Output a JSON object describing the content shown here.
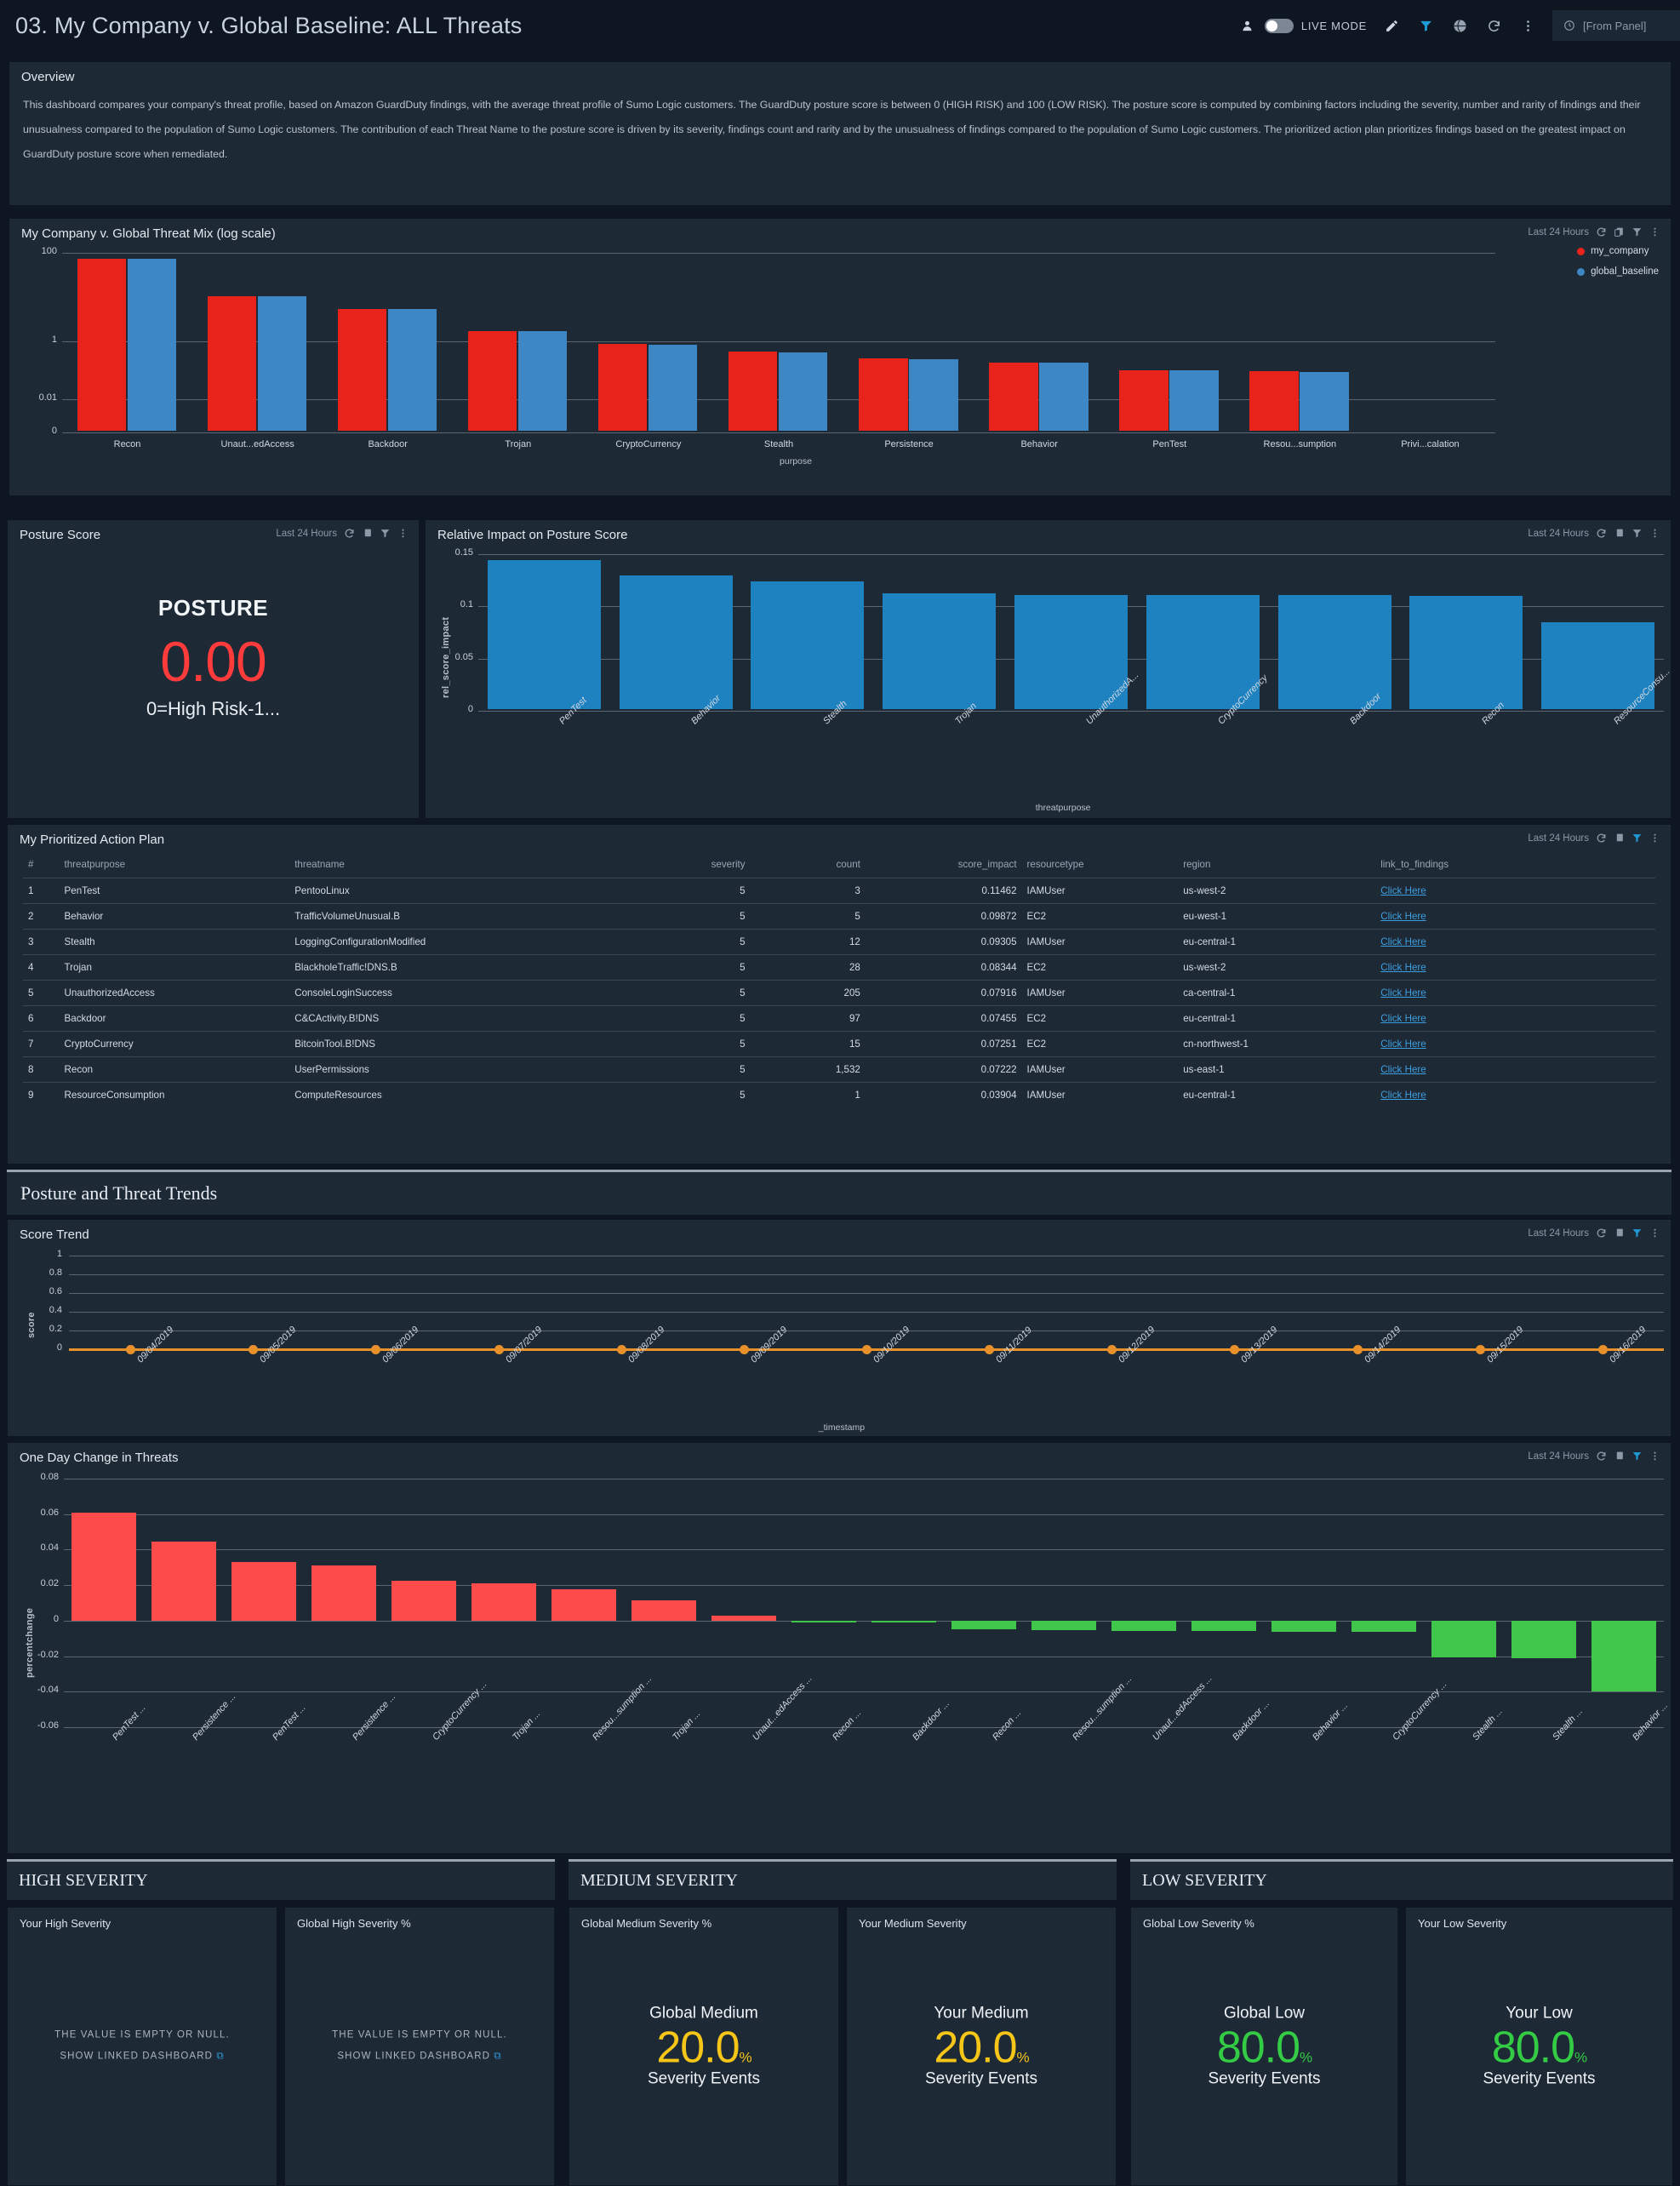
{
  "header": {
    "title": "03. My Company v. Global Baseline: ALL Threats",
    "live_mode_label": "LIVE MODE",
    "time_range": "[From Panel]",
    "icons": [
      "person-icon",
      "edit-pencil-icon",
      "filter-icon",
      "globe-icon",
      "refresh-icon",
      "more-vertical-icon",
      "clock-icon"
    ]
  },
  "overview": {
    "title": "Overview",
    "text": "This dashboard compares your company's threat profile, based on Amazon GuardDuty findings, with the average threat profile of Sumo Logic customers. The GuardDuty posture score is between 0 (HIGH RISK) and 100 (LOW RISK). The posture score is computed by combining factors including the severity, number and rarity of findings and their unusualness compared to the population of Sumo Logic customers. The contribution of each Threat Name to the posture score is driven by its severity, findings count and rarity and by the unusualness of findings compared to the population of Sumo Logic customers. The prioritized action plan prioritizes findings based on the greatest impact on GuardDuty posture score when remediated."
  },
  "panel_meta": {
    "time_label": "Last 24 Hours"
  },
  "threat_mix": {
    "title": "My Company v. Global Threat Mix (log scale)",
    "legend": [
      "my_company",
      "global_baseline"
    ]
  },
  "posture": {
    "title": "Posture Score",
    "label": "POSTURE",
    "value": "0.00",
    "caption": "0=High Risk-1...",
    "color": "#ff3b3b"
  },
  "rel_impact": {
    "title": "Relative Impact on Posture Score"
  },
  "action_plan": {
    "title": "My Prioritized Action Plan",
    "columns": [
      "#",
      "threatpurpose",
      "threatname",
      "severity",
      "count",
      "score_impact",
      "resourcetype",
      "region",
      "link_to_findings"
    ],
    "rows": [
      [
        "1",
        "PenTest",
        "PentooLinux",
        "5",
        "3",
        "0.11462",
        "IAMUser",
        "us-west-2",
        "Click Here"
      ],
      [
        "2",
        "Behavior",
        "TrafficVolumeUnusual.B",
        "5",
        "5",
        "0.09872",
        "EC2",
        "eu-west-1",
        "Click Here"
      ],
      [
        "3",
        "Stealth",
        "LoggingConfigurationModified",
        "5",
        "12",
        "0.09305",
        "IAMUser",
        "eu-central-1",
        "Click Here"
      ],
      [
        "4",
        "Trojan",
        "BlackholeTraffic!DNS.B",
        "5",
        "28",
        "0.08344",
        "EC2",
        "us-west-2",
        "Click Here"
      ],
      [
        "5",
        "UnauthorizedAccess",
        "ConsoleLoginSuccess",
        "5",
        "205",
        "0.07916",
        "IAMUser",
        "ca-central-1",
        "Click Here"
      ],
      [
        "6",
        "Backdoor",
        "C&CActivity.B!DNS",
        "5",
        "97",
        "0.07455",
        "EC2",
        "eu-central-1",
        "Click Here"
      ],
      [
        "7",
        "CryptoCurrency",
        "BitcoinTool.B!DNS",
        "5",
        "15",
        "0.07251",
        "EC2",
        "cn-northwest-1",
        "Click Here"
      ],
      [
        "8",
        "Recon",
        "UserPermissions",
        "5",
        "1,532",
        "0.07222",
        "IAMUser",
        "us-east-1",
        "Click Here"
      ],
      [
        "9",
        "ResourceConsumption",
        "ComputeResources",
        "5",
        "1",
        "0.03904",
        "IAMUser",
        "eu-central-1",
        "Click Here"
      ]
    ]
  },
  "trends_section": {
    "title": "Posture and Threat Trends"
  },
  "score_trend": {
    "title": "Score Trend"
  },
  "one_day_change": {
    "title": "One Day Change in Threats"
  },
  "severity_sections": [
    {
      "heading": "HIGH SEVERITY",
      "cards": [
        {
          "caption": "Your High Severity",
          "kind": "null",
          "null_text": "THE VALUE IS EMPTY OR NULL.",
          "link_text": "SHOW LINKED DASHBOARD"
        },
        {
          "caption": "Global High Severity %",
          "kind": "null",
          "null_text": "THE VALUE IS EMPTY OR NULL.",
          "link_text": "SHOW LINKED DASHBOARD"
        }
      ]
    },
    {
      "heading": "MEDIUM SEVERITY",
      "cards": [
        {
          "caption": "Global Medium Severity %",
          "kind": "value",
          "title": "Global Medium",
          "value": "20.0",
          "unit": "%",
          "sub": "Severity Events",
          "color": "#f5c518"
        },
        {
          "caption": "Your Medium Severity",
          "kind": "value",
          "title": "Your Medium",
          "value": "20.0",
          "unit": "%",
          "sub": "Severity Events",
          "color": "#f5c518"
        }
      ]
    },
    {
      "heading": "LOW SEVERITY",
      "cards": [
        {
          "caption": "Global Low Severity %",
          "kind": "value",
          "title": "Global Low",
          "value": "80.0",
          "unit": "%",
          "sub": "Severity Events",
          "color": "#33cc44"
        },
        {
          "caption": "Your Low Severity",
          "kind": "value",
          "title": "Your Low",
          "value": "80.0",
          "unit": "%",
          "sub": "Severity Events",
          "color": "#33cc44"
        }
      ]
    }
  ],
  "chart_data": [
    {
      "type": "bar",
      "id": "threat_mix",
      "title": "My Company v. Global Threat Mix (log scale)",
      "xlabel": "purpose",
      "ylabel": "",
      "scale": "log",
      "yticks": [
        "100",
        "1",
        "0.01",
        "0"
      ],
      "categories": [
        "Recon",
        "Unaut...edAccess",
        "Backdoor",
        "Trojan",
        "CryptoCurrency",
        "Stealth",
        "Persistence",
        "Behavior",
        "PenTest",
        "Resou...sumption",
        "Privi...calation"
      ],
      "series": [
        {
          "name": "my_company",
          "color": "#e8231c",
          "values": [
            85,
            9.5,
            4.5,
            1.25,
            0.62,
            0.4,
            0.26,
            0.21,
            0.135,
            0.125,
            0.0008
          ]
        },
        {
          "name": "global_baseline",
          "color": "#3d87c4",
          "values": [
            85,
            9.5,
            4.5,
            1.25,
            0.58,
            0.38,
            0.25,
            0.205,
            0.13,
            0.122,
            0.0
          ]
        }
      ],
      "legend_position": "right",
      "grid": true
    },
    {
      "type": "bar",
      "id": "rel_impact",
      "title": "Relative Impact on Posture Score",
      "xlabel": "threatpurpose",
      "ylabel": "rel_score_impact",
      "ylim": [
        0,
        0.15
      ],
      "yticks": [
        "0.15",
        "0.1",
        "0.05",
        "0"
      ],
      "categories": [
        "PenTest",
        "Behavior",
        "Stealth",
        "Trojan",
        "UnauthorizedA...",
        "CryptoCurrency",
        "Backdoor",
        "Recon",
        "ResourceConsu..."
      ],
      "values": [
        0.1426,
        0.1277,
        0.1223,
        0.1112,
        0.1095,
        0.1095,
        0.109,
        0.1085,
        0.0829
      ],
      "color": "#1f82c0",
      "grid": true
    },
    {
      "type": "line",
      "id": "score_trend",
      "title": "Score Trend",
      "xlabel": "_timestamp",
      "ylabel": "score",
      "ylim": [
        0,
        1
      ],
      "yticks": [
        "1",
        "0.8",
        "0.6",
        "0.4",
        "0.2",
        "0"
      ],
      "x": [
        "09/04/2019",
        "09/05/2019",
        "09/06/2019",
        "09/07/2019",
        "09/08/2019",
        "09/09/2019",
        "09/10/2019",
        "09/11/2019",
        "09/12/2019",
        "09/13/2019",
        "09/14/2019",
        "09/15/2019",
        "09/16/2019"
      ],
      "values": [
        0,
        0,
        0,
        0,
        0,
        0,
        0,
        0,
        0,
        0,
        0,
        0,
        0
      ],
      "color": "#e8912a",
      "grid": true
    },
    {
      "type": "bar",
      "id": "one_day_change",
      "title": "One Day Change in Threats",
      "xlabel": "",
      "ylabel": "percentchange",
      "ylim": [
        -0.06,
        0.08
      ],
      "yticks": [
        "0.08",
        "0.06",
        "0.04",
        "0.02",
        "0",
        "-0.02",
        "-0.04",
        "-0.06"
      ],
      "categories": [
        "PenTest ...",
        "Persistence ...",
        "PenTest ...",
        "Persistence ...",
        "CryptoCurrency ...",
        "Trojan ...",
        "Resou...sumption ...",
        "Trojan ...",
        "Unaut...edAccess ...",
        "Recon ...",
        "Backdoor ...",
        "Recon ...",
        "Resou...sumption ...",
        "Unaut...edAccess ...",
        "Backdoor ...",
        "Behavior ...",
        "CryptoCurrency ...",
        "Stealth ...",
        "Stealth ...",
        "Behavior ..."
      ],
      "values": [
        0.061,
        0.0444,
        0.0328,
        0.0312,
        0.0226,
        0.0208,
        0.0175,
        0.0115,
        0.003,
        -0.001,
        -0.0012,
        -0.0048,
        -0.0055,
        -0.0058,
        -0.006,
        -0.0062,
        -0.0065,
        -0.0205,
        -0.021,
        -0.04
      ],
      "positive_color": "#fd4a4a",
      "negative_color": "#3fc64b",
      "grid": true
    }
  ]
}
